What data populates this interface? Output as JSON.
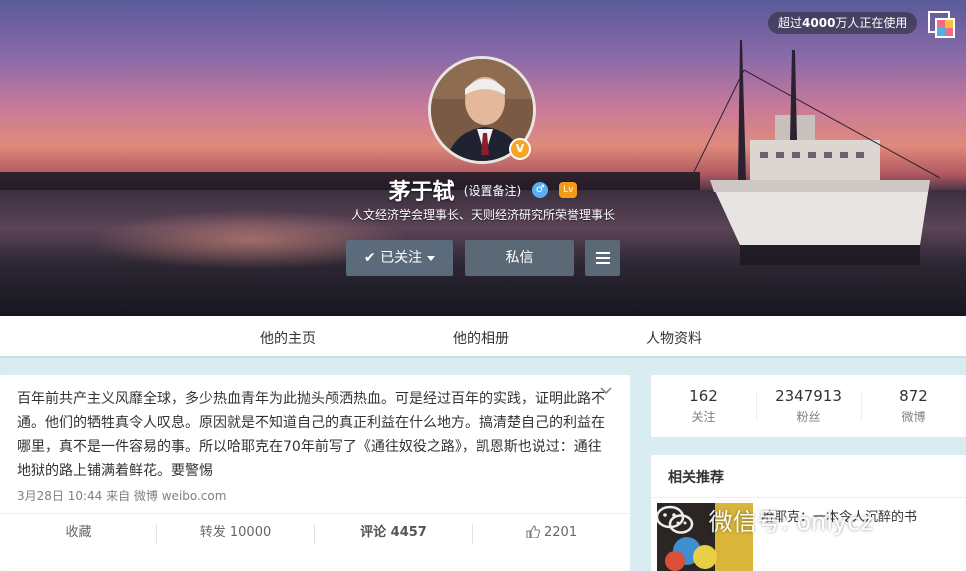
{
  "cover": {
    "users_badge_prefix": "超过",
    "users_badge_count": "4000",
    "users_badge_suffix": "万人正在使用"
  },
  "profile": {
    "name": "茅于轼",
    "remark_link": "(设置备注)",
    "verified_mark": "V",
    "gender_symbol": "♂",
    "level_mark": "Lv",
    "subtitle": "人文经济学会理事长、天则经济研究所荣誉理事长",
    "follow_button": "已关注",
    "message_button": "私信"
  },
  "nav": {
    "home": "他的主页",
    "album": "他的相册",
    "info": "人物资料"
  },
  "post": {
    "text": "百年前共产主义风靡全球，多少热血青年为此抛头颅洒热血。可是经过百年的实践，证明此路不通。他们的牺牲真令人叹息。原因就是不知道自己的真正利益在什么地方。搞清楚自己的利益在哪里，真不是一件容易的事。所以哈耶克在70年前写了《通往奴役之路》，凯恩斯也说过：通往地狱的路上铺满着鲜花。要警惕",
    "meta": "3月28日 10:44 来自 微博 weibo.com",
    "actions": {
      "favorite": "收藏",
      "repost": "转发 10000",
      "comment": "评论 4457",
      "like": "2201"
    }
  },
  "stats": [
    {
      "num": "162",
      "label": "关注"
    },
    {
      "num": "2347913",
      "label": "粉丝"
    },
    {
      "num": "872",
      "label": "微博"
    }
  ],
  "related": {
    "title": "相关推荐",
    "book_title": "哈耶克：一本令人沉醉的书"
  },
  "watermark": {
    "text": "微信号: onlycz"
  }
}
